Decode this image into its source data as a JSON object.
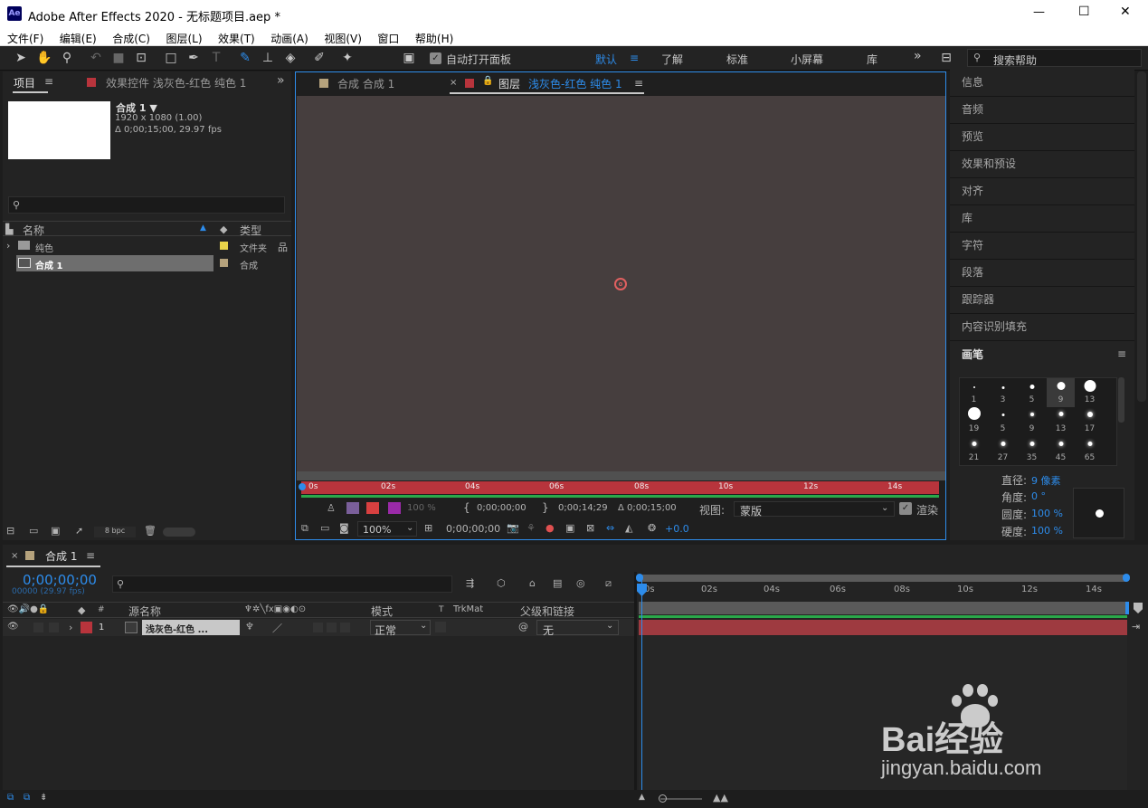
{
  "window": {
    "title": "Adobe After Effects 2020 - 无标题项目.aep *",
    "app_badge": "Ae",
    "minimize": "—",
    "maximize": "☐",
    "close": "✕"
  },
  "menu": [
    "文件(F)",
    "编辑(E)",
    "合成(C)",
    "图层(L)",
    "效果(T)",
    "动画(A)",
    "视图(V)",
    "窗口",
    "帮助(H)"
  ],
  "toolbar": {
    "auto_open_label": "自动打开面板",
    "workspaces": [
      "默认",
      "了解",
      "标准",
      "小屏幕",
      "库"
    ],
    "more": "»",
    "search_placeholder": "搜索帮助"
  },
  "project": {
    "tab_label": "项目",
    "effects_tab": "效果控件 浅灰色-红色 纯色 1",
    "comp_name": "合成 1 ▼",
    "comp_res": "1920 x 1080 (1.00)",
    "comp_dur": "Δ 0;00;15;00, 29.97 fps",
    "col_name": "名称",
    "col_type": "类型",
    "items": [
      {
        "name": "纯色",
        "type": "文件夹",
        "color": "#e8d44a"
      },
      {
        "name": "合成 1",
        "type": "合成",
        "color": "#b5a27c"
      }
    ],
    "bpc": "8 bpc"
  },
  "viewer": {
    "tab1": "合成 合成 1",
    "tab2_prefix": "图层",
    "tab2_name": "浅灰色-红色 纯色 1",
    "ruler": [
      "0s",
      "02s",
      "04s",
      "06s",
      "08s",
      "10s",
      "12s",
      "14s"
    ],
    "t_in": "0;00;00;00",
    "t_out": "0;00;14;29",
    "t_dur": "Δ 0;00;15;00",
    "view_label": "视图:",
    "view_value": "蒙版",
    "render_label": "渲染",
    "zoom": "100%",
    "timecode": "0;00;00;00",
    "exposure": "+0.0",
    "pct": "100 %"
  },
  "right": {
    "items": [
      "信息",
      "音频",
      "预览",
      "效果和预设",
      "对齐",
      "库",
      "字符",
      "段落",
      "跟踪器",
      "内容识别填充"
    ],
    "brush_title": "画笔",
    "brushes": [
      [
        "1",
        "3",
        "5",
        "9",
        "13"
      ],
      [
        "19",
        "5",
        "9",
        "13",
        "17"
      ],
      [
        "21",
        "27",
        "35",
        "45",
        "65"
      ]
    ],
    "diameter": "直径:",
    "diameter_v": "9 像素",
    "angle": "角度:",
    "angle_v": "0 °",
    "roundness": "圆度:",
    "roundness_v": "100 %",
    "hardness": "硬度:",
    "hardness_v": "100 %"
  },
  "timeline": {
    "tab": "合成 1",
    "timecode": "0;00;00;00",
    "fps": "00000 (29.97 fps)",
    "cols": {
      "num": "#",
      "src": "源名称",
      "mode": "模式",
      "t": "T",
      "trkmat": "TrkMat",
      "parent": "父级和链接"
    },
    "layer": {
      "num": "1",
      "name": "浅灰色-红色 ...",
      "mode": "正常",
      "parent": "无"
    },
    "ruler": [
      "0s",
      "02s",
      "04s",
      "06s",
      "08s",
      "10s",
      "12s",
      "14s"
    ]
  },
  "watermark": {
    "brand": "Bai经验",
    "url": "jingyan.baidu.com"
  },
  "colors": {
    "accent": "#2d8ceb",
    "layer_red": "#b8343c",
    "viewer_bg": "#463e3e"
  }
}
